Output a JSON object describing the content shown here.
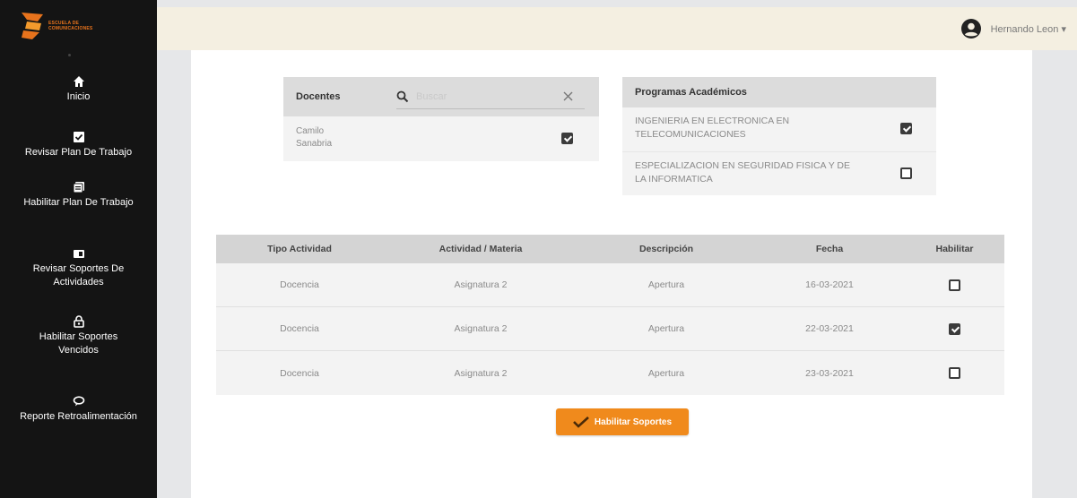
{
  "brand": {
    "line1": "Escuela de",
    "line2": "Comunicaciones",
    "color": "#e8731c"
  },
  "sidebar": {
    "items": [
      {
        "label": "Inicio",
        "icon": "home-icon"
      },
      {
        "label": "Revisar Plan De Trabajo",
        "icon": "checkbox-icon"
      },
      {
        "label": "Habilitar Plan De Trabajo",
        "icon": "document-icon"
      },
      {
        "label": "Revisar Soportes De Actividades",
        "icon": "folder-icon"
      },
      {
        "label": "Habilitar Soportes Vencidos",
        "icon": "lock-icon"
      },
      {
        "label": "Reporte Retroalimentación",
        "icon": "feedback-icon"
      }
    ]
  },
  "topbar": {
    "user_name": "Hernando Leon",
    "caret": "▾"
  },
  "docentes": {
    "title": "Docentes",
    "search_placeholder": "Buscar",
    "items": [
      {
        "name": "Camilo Sanabria",
        "checked": true
      }
    ]
  },
  "programas": {
    "title": "Programas Académicos",
    "items": [
      {
        "name": "INGENIERIA EN ELECTRONICA EN TELECOMUNICACIONES",
        "checked": true
      },
      {
        "name": "ESPECIALIZACION EN SEGURIDAD FISICA Y DE LA INFORMATICA",
        "checked": false
      }
    ]
  },
  "table": {
    "headers": [
      "Tipo Actividad",
      "Actividad / Materia",
      "Descripción",
      "Fecha",
      "Habilitar"
    ],
    "rows": [
      {
        "tipo": "Docencia",
        "materia": "Asignatura 2",
        "descripcion": "Apertura",
        "fecha": "16-03-2021",
        "habilitar": false
      },
      {
        "tipo": "Docencia",
        "materia": "Asignatura 2",
        "descripcion": "Apertura",
        "fecha": "22-03-2021",
        "habilitar": true
      },
      {
        "tipo": "Docencia",
        "materia": "Asignatura 2",
        "descripcion": "Apertura",
        "fecha": "23-03-2021",
        "habilitar": false
      }
    ]
  },
  "actions": {
    "submit_label": "Habilitar Soportes",
    "accent": "#f08a1c"
  }
}
